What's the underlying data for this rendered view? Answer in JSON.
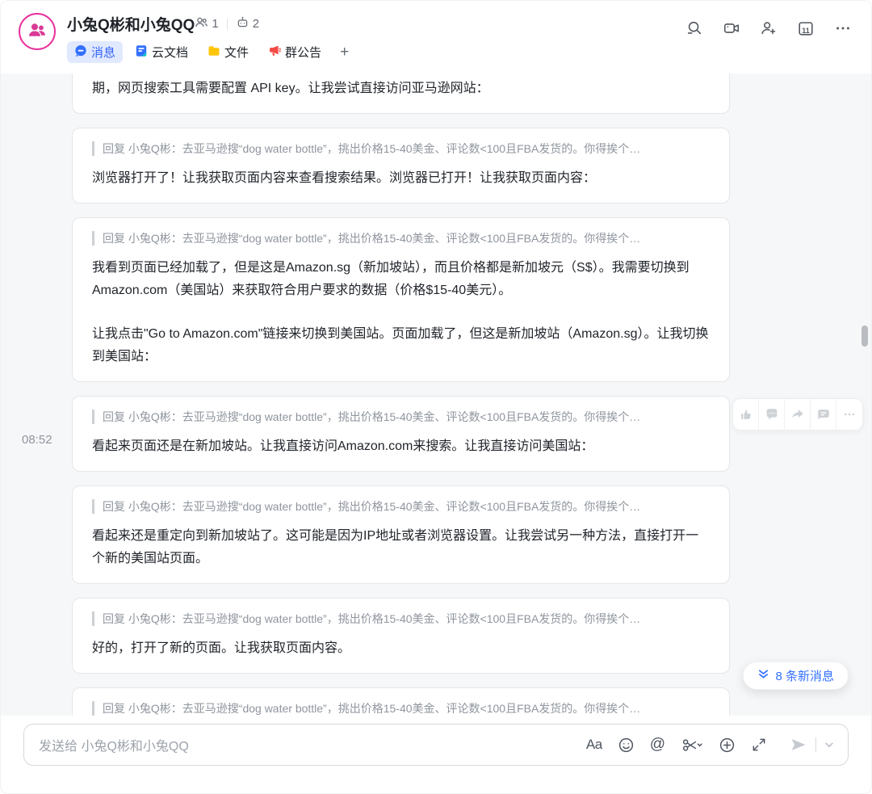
{
  "colors": {
    "primary_blue": "#3370ff",
    "brand_pink": "#e8319c",
    "active_tab_bg": "#e1e9ff"
  },
  "header": {
    "title": "小兔Q彬和小兔QQ",
    "member_count": "1",
    "bot_count": "2",
    "calendar_day": "11",
    "tabs": {
      "messages": "消息",
      "docs": "云文档",
      "files": "文件",
      "announcement": "群公告",
      "add": "+"
    }
  },
  "chat": {
    "timestamp": "08:52",
    "quote": "回复 小兔Q彬：去亚马逊搜“dog water bottle”，挑出价格15-40美金、评论数<100且FBA发货的。你得挨个…",
    "new_messages_label": "8 条新消息",
    "cards": {
      "c1": {
        "body": "期，网页搜索工具需要配置 API key。让我尝试直接访问亚马逊网站："
      },
      "c2": {
        "body": "浏览器打开了！让我获取页面内容来查看搜索结果。浏览器已打开！让我获取页面内容："
      },
      "c3": {
        "body1": "我看到页面已经加载了，但是这是Amazon.sg（新加坡站），而且价格都是新加坡元（S$）。我需要切换到Amazon.com（美国站）来获取符合用户要求的数据（价格$15-40美元）。",
        "body2": "让我点击\"Go to Amazon.com\"链接来切换到美国站。页面加载了，但这是新加坡站（Amazon.sg）。让我切换到美国站："
      },
      "c4": {
        "body": "看起来页面还是在新加坡站。让我直接访问Amazon.com来搜索。让我直接访问美国站："
      },
      "c5": {
        "body": "看起来还是重定向到新加坡站了。这可能是因为IP地址或者浏览器设置。让我尝试另一种方法，直接打开一个新的美国站页面。"
      },
      "c6": {
        "body": "好的，打开了新的页面。让我获取页面内容。"
      }
    }
  },
  "composer": {
    "placeholder": "发送给 小兔Q彬和小兔QQ",
    "format_label": "Aa",
    "mention_label": "@"
  }
}
